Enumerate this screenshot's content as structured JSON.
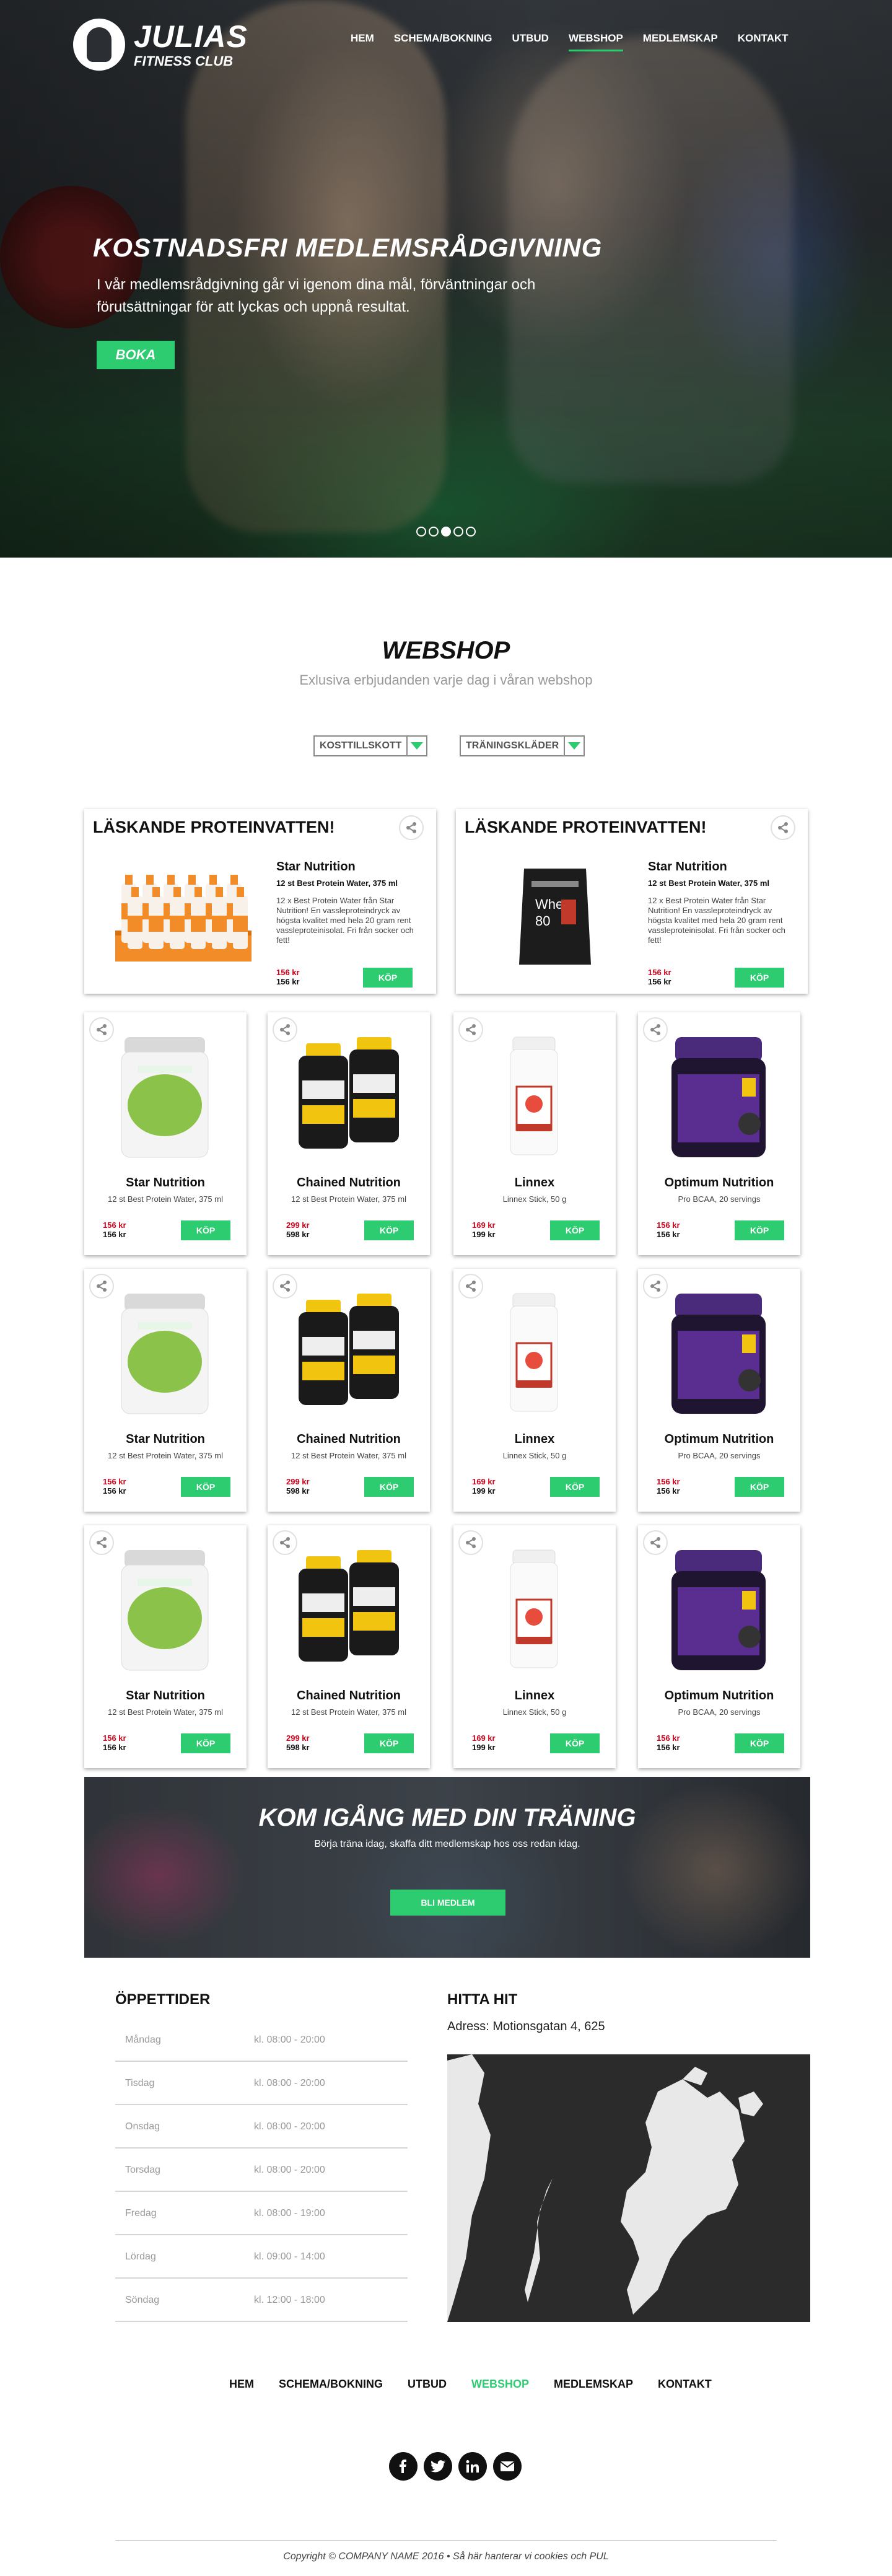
{
  "brand": {
    "title": "JULIAS",
    "subtitle": "FITNESS CLUB"
  },
  "nav": [
    "HEM",
    "SCHEMA/BOKNING",
    "UTBUD",
    "WEBSHOP",
    "MEDLEMSKAP",
    "KONTAKT"
  ],
  "nav_active": "WEBSHOP",
  "hero": {
    "title": "KOSTNADSFRI MEDLEMSRÅDGIVNING",
    "text": "I vår medlemsrådgivning går vi igenom dina mål, förväntningar och förutsättningar för att lyckas och uppnå resultat.",
    "button": "BOKA",
    "slides": 5,
    "active_slide": 3
  },
  "webshop": {
    "title": "WEBSHOP",
    "subtitle": "Exlusiva erbjudanden varje dag i våran webshop",
    "filters": [
      "KOSTTILLSKOTT",
      "TRÄNINGSKLÄDER"
    ]
  },
  "featured": [
    {
      "title": "LÄSKANDE PROTEINVATTEN!",
      "brand": "Star Nutrition",
      "sub": "12 st Best Protein Water, 375 ml",
      "desc": "12 x Best Protein Water från Star Nutrition! En vassleproteindryck av högsta kvalitet med hela 20 gram rent vassleproteinisolat. Fri från socker och fett!",
      "price_new": "156 kr",
      "price_old": "156 kr",
      "buy": "KÖP",
      "image": "protein-water-pack"
    },
    {
      "title": "LÄSKANDE PROTEINVATTEN!",
      "brand": "Star Nutrition",
      "sub": "12 st Best Protein Water, 375 ml",
      "desc": "12 x Best Protein Water från Star Nutrition! En vassleproteindryck av högsta kvalitet med hela 20 gram rent vassleproteinisolat. Fri från socker och fett!",
      "price_new": "156 kr",
      "price_old": "156 kr",
      "buy": "KÖP",
      "image": "whey-bag"
    }
  ],
  "products": [
    {
      "brand": "Star Nutrition",
      "sub": "12 st Best Protein Water, 375 ml",
      "price_new": "156 kr",
      "price_old": "156 kr",
      "buy": "KÖP",
      "image": "tub-green"
    },
    {
      "brand": "Chained Nutrition",
      "sub": "12 st Best Protein Water, 375 ml",
      "price_new": "299 kr",
      "price_old": "598 kr",
      "buy": "KÖP",
      "image": "ripped-bottles"
    },
    {
      "brand": "Linnex",
      "sub": "Linnex Stick, 50 g",
      "price_new": "169 kr",
      "price_old": "199 kr",
      "buy": "KÖP",
      "image": "linnex-stick"
    },
    {
      "brand": "Optimum Nutrition",
      "sub": "Pro BCAA, 20 servings",
      "price_new": "156 kr",
      "price_old": "156 kr",
      "buy": "KÖP",
      "image": "pro-bcaa"
    },
    {
      "brand": "Star Nutrition",
      "sub": "12 st Best Protein Water, 375 ml",
      "price_new": "156 kr",
      "price_old": "156 kr",
      "buy": "KÖP",
      "image": "tub-green"
    },
    {
      "brand": "Chained Nutrition",
      "sub": "12 st Best Protein Water, 375 ml",
      "price_new": "299 kr",
      "price_old": "598 kr",
      "buy": "KÖP",
      "image": "ripped-bottles"
    },
    {
      "brand": "Linnex",
      "sub": "Linnex Stick, 50 g",
      "price_new": "169 kr",
      "price_old": "199 kr",
      "buy": "KÖP",
      "image": "linnex-stick"
    },
    {
      "brand": "Optimum Nutrition",
      "sub": "Pro BCAA, 20 servings",
      "price_new": "156 kr",
      "price_old": "156 kr",
      "buy": "KÖP",
      "image": "pro-bcaa"
    },
    {
      "brand": "Star Nutrition",
      "sub": "12 st Best Protein Water, 375 ml",
      "price_new": "156 kr",
      "price_old": "156 kr",
      "buy": "KÖP",
      "image": "tub-green"
    },
    {
      "brand": "Chained Nutrition",
      "sub": "12 st Best Protein Water, 375 ml",
      "price_new": "299 kr",
      "price_old": "598 kr",
      "buy": "KÖP",
      "image": "ripped-bottles"
    },
    {
      "brand": "Linnex",
      "sub": "Linnex Stick, 50 g",
      "price_new": "169 kr",
      "price_old": "199 kr",
      "buy": "KÖP",
      "image": "linnex-stick"
    },
    {
      "brand": "Optimum Nutrition",
      "sub": "Pro BCAA, 20 servings",
      "price_new": "156 kr",
      "price_old": "156 kr",
      "buy": "KÖP",
      "image": "pro-bcaa"
    }
  ],
  "cta": {
    "title": "KOM IGÅNG MED DIN TRÄNING",
    "text": "Börja träna idag, skaffa ditt medlemskap hos oss redan idag.",
    "button": "BLI MEDLEM"
  },
  "hours": {
    "title": "ÖPPETTIDER",
    "rows": [
      {
        "day": "Måndag",
        "time": "kl. 08:00 - 20:00"
      },
      {
        "day": "Tisdag",
        "time": "kl. 08:00 - 20:00"
      },
      {
        "day": "Onsdag",
        "time": "kl. 08:00 - 20:00"
      },
      {
        "day": "Torsdag",
        "time": "kl. 08:00 - 20:00"
      },
      {
        "day": "Fredag",
        "time": "kl. 08:00 - 19:00"
      },
      {
        "day": "Lördag",
        "time": "kl. 09:00 - 14:00"
      },
      {
        "day": "Söndag",
        "time": "kl. 12:00 - 18:00"
      }
    ]
  },
  "find": {
    "title": "HITTA HIT",
    "address": "Adress: Motionsgatan 4, 625"
  },
  "footer": {
    "nav": [
      "HEM",
      "SCHEMA/BOKNING",
      "UTBUD",
      "WEBSHOP",
      "MEDLEMSKAP",
      "KONTAKT"
    ],
    "socials": [
      "facebook-icon",
      "twitter-icon",
      "linkedin-icon",
      "email-icon"
    ],
    "copyright": "Copyright © COMPANY NAME 2016 • Så här hanterar vi cookies och PUL"
  },
  "colors": {
    "accent": "#2ecc71",
    "price_red": "#d0021b"
  }
}
